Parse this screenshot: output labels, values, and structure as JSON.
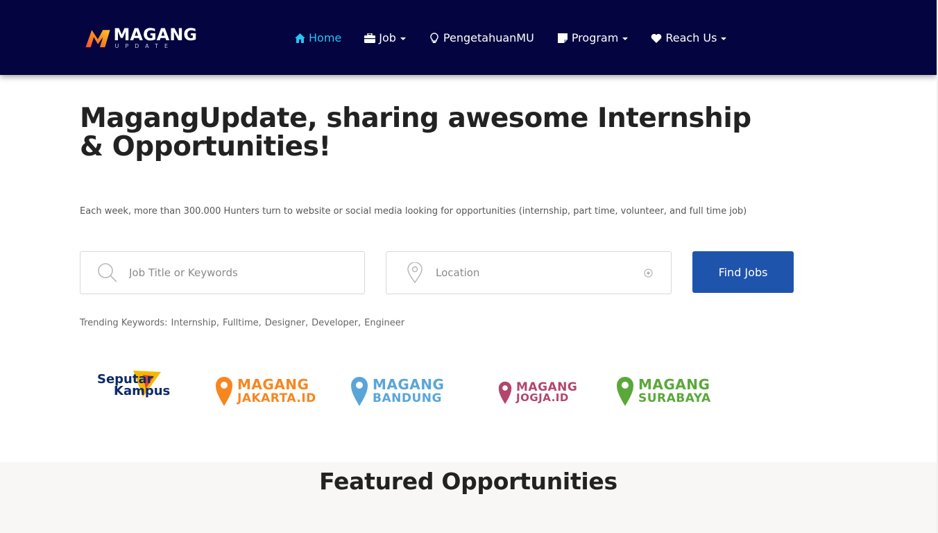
{
  "brand": {
    "name": "MAGANG",
    "tagline": "UPDATE",
    "colors": {
      "navbar": "#030440",
      "active_link": "#27c3f1",
      "button": "#1f54ad"
    }
  },
  "nav": {
    "items": [
      {
        "label": "Home",
        "icon": "home-icon",
        "active": true,
        "dropdown": false
      },
      {
        "label": "Job",
        "icon": "briefcase-icon",
        "active": false,
        "dropdown": true
      },
      {
        "label": "PengetahuanMU",
        "icon": "lightbulb-icon",
        "active": false,
        "dropdown": false
      },
      {
        "label": "Program",
        "icon": "sticky-note-icon",
        "active": false,
        "dropdown": true
      },
      {
        "label": "Reach Us",
        "icon": "heart-icon",
        "active": false,
        "dropdown": true
      }
    ]
  },
  "hero": {
    "title": "MagangUpdate, sharing awesome Internship & Opportunities!",
    "subtitle": "Each week, more than 300.000 Hunters turn to website or social media looking for opportunities (internship, part time, volunteer, and full time job)"
  },
  "search": {
    "keyword_placeholder": "Job Title or Keywords",
    "keyword_value": "",
    "location_placeholder": "Location",
    "location_value": "",
    "button_label": "Find Jobs"
  },
  "trending": {
    "label": "Trending Keywords:",
    "keywords": [
      "Internship,",
      "Fulltime,",
      "Designer,",
      "Developer,",
      "Engineer"
    ]
  },
  "partners": {
    "seputar": {
      "line1": "Seputar",
      "line2": "Kampus",
      "color": "#0c2a6a",
      "accent": "#f5b800"
    },
    "jakarta": {
      "line1": "MAGANG",
      "line2": "JAKARTA.ID",
      "color": "#f7861f"
    },
    "bandung": {
      "line1": "MAGANG",
      "line2": "BANDUNG",
      "color": "#5aa5d8"
    },
    "jogja": {
      "line1": "MAGANG",
      "line2": "JOGJA.ID",
      "color": "#b2466e"
    },
    "surabaya": {
      "line1": "MAGANG",
      "line2": "SURABAYA",
      "color": "#5aa83a"
    }
  },
  "featured": {
    "title": "Featured Opportunities"
  }
}
